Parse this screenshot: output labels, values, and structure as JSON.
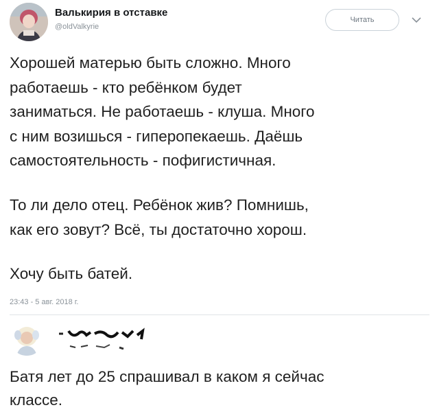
{
  "tweet": {
    "display_name": "Валькирия в отставке",
    "handle": "@oldValkyrie",
    "follow_label": "Читать",
    "paragraph_1": [
      "Хорошей матерью быть сложно. Много",
      "работаешь - кто ребёнком будет",
      "заниматься. Не работаешь - клуша. Много",
      "с ним возишься - гиперопекаешь. Даёшь",
      "самостоятельность - пофигистичная."
    ],
    "paragraph_2": [
      "То ли дело отец. Ребёнок жив? Помнишь,",
      "как его зовут? Всё, ты достаточно хорош."
    ],
    "paragraph_3": [
      "Хочу быть батей."
    ],
    "timestamp": "23:43 - 5 авг. 2018 г."
  },
  "reply": {
    "text": [
      "Батя лет до 25 спрашивал в каком я сейчас",
      "классе."
    ]
  },
  "colors": {
    "text": "#1f1f1f",
    "muted": "#8a9299",
    "divider": "#dfe3e6",
    "button_border": "#c9d1d8"
  },
  "icons": {
    "menu": "chevron-down-icon"
  }
}
